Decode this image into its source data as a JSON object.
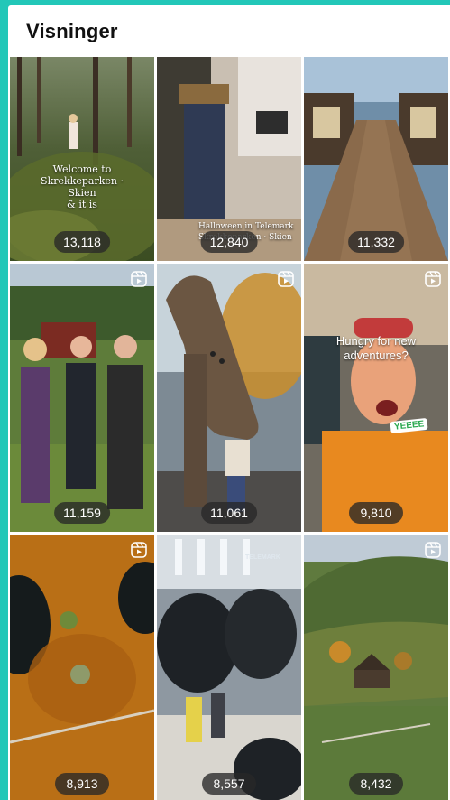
{
  "header": {
    "title": "Visninger"
  },
  "tiles": [
    {
      "views": "13,118",
      "reel": false,
      "overlay": "Welcome to\nSkrekkeparken · Skien\n& it is"
    },
    {
      "views": "12,840",
      "reel": false,
      "overlay": "Halloween in Telemark\nSkrekkeparken · Skien"
    },
    {
      "views": "11,332",
      "reel": false,
      "overlay": ""
    },
    {
      "views": "11,159",
      "reel": true,
      "overlay": ""
    },
    {
      "views": "11,061",
      "reel": true,
      "overlay": ""
    },
    {
      "views": "9,810",
      "reel": true,
      "overlay": "Hungry for new\nadventures?",
      "sticker": "YEEEE"
    },
    {
      "views": "8,913",
      "reel": true,
      "overlay": ""
    },
    {
      "views": "8,557",
      "reel": false,
      "overlay": "",
      "watermark": "TELEMARK"
    },
    {
      "views": "8,432",
      "reel": true,
      "overlay": ""
    }
  ],
  "colors": {
    "frame_accent": "#22c7b8",
    "pill_bg": "#282828",
    "sticker_text": "#2aa84f"
  },
  "icons": {
    "reel": "reels-icon"
  }
}
